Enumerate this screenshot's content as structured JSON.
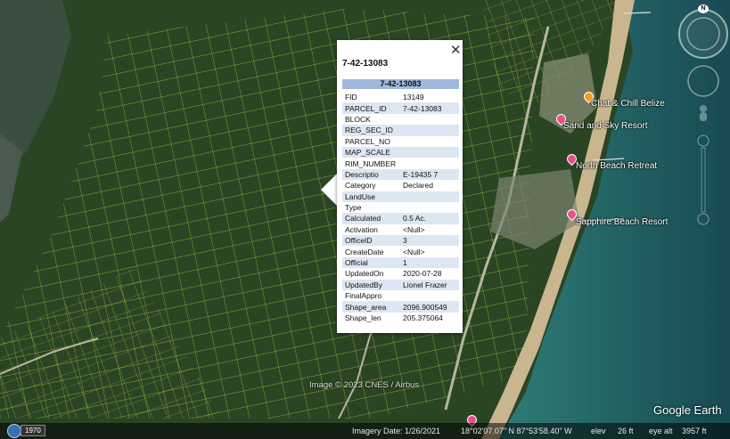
{
  "popup": {
    "title": "7-42-13083",
    "header": "7-42-13083",
    "close": "✕",
    "rows": [
      [
        "FID",
        "13149"
      ],
      [
        "PARCEL_ID",
        "7-42-13083"
      ],
      [
        "BLOCK",
        ""
      ],
      [
        "REG_SEC_ID",
        ""
      ],
      [
        "PARCEL_NO",
        ""
      ],
      [
        "MAP_SCALE",
        ""
      ],
      [
        "RIM_NUMBER",
        ""
      ],
      [
        "Descriptio",
        "E-19435 7"
      ],
      [
        "Category",
        "Declared"
      ],
      [
        "LandUse",
        ""
      ],
      [
        "Type",
        ""
      ],
      [
        "Calculated",
        "0.5 Ac."
      ],
      [
        "Activation",
        "<Null>"
      ],
      [
        "OfficeID",
        "3"
      ],
      [
        "CreateDate",
        "<Null>"
      ],
      [
        "Official",
        "1"
      ],
      [
        "UpdatedOn",
        "2020-07-28"
      ],
      [
        "UpdatedBy",
        "Lionel Frazer"
      ],
      [
        "FinalAppro",
        ""
      ],
      [
        "Shape_area",
        "2096.900549"
      ],
      [
        "Shape_len",
        "205.375064"
      ]
    ]
  },
  "places": [
    {
      "name": "Chat & Chill Belize",
      "color": "#f0a020"
    },
    {
      "name": "Sand and Sky Resort",
      "color": "#e8508a"
    },
    {
      "name": "North Beach Retreat",
      "color": "#e8508a"
    },
    {
      "name": "Sapphire Beach Resort",
      "color": "#e8508a"
    }
  ],
  "credit": "Image © 2023 CNES / Airbus",
  "logo": "Google Earth",
  "status": {
    "year": "1970",
    "imagery_date": "Imagery Date: 1/26/2021",
    "coords": "18°02'07.07\" N  87°53'58.40\" W",
    "elev_label": "elev",
    "elev": "26 ft",
    "eye_alt_label": "eye alt",
    "eye_alt": "3957 ft"
  },
  "nav": {
    "north": "N"
  },
  "colors": {
    "parcel_lines": "#d4d040",
    "water": "#1f5f63",
    "beach": "#c9b68e",
    "vegetation": "#2c4a26"
  }
}
